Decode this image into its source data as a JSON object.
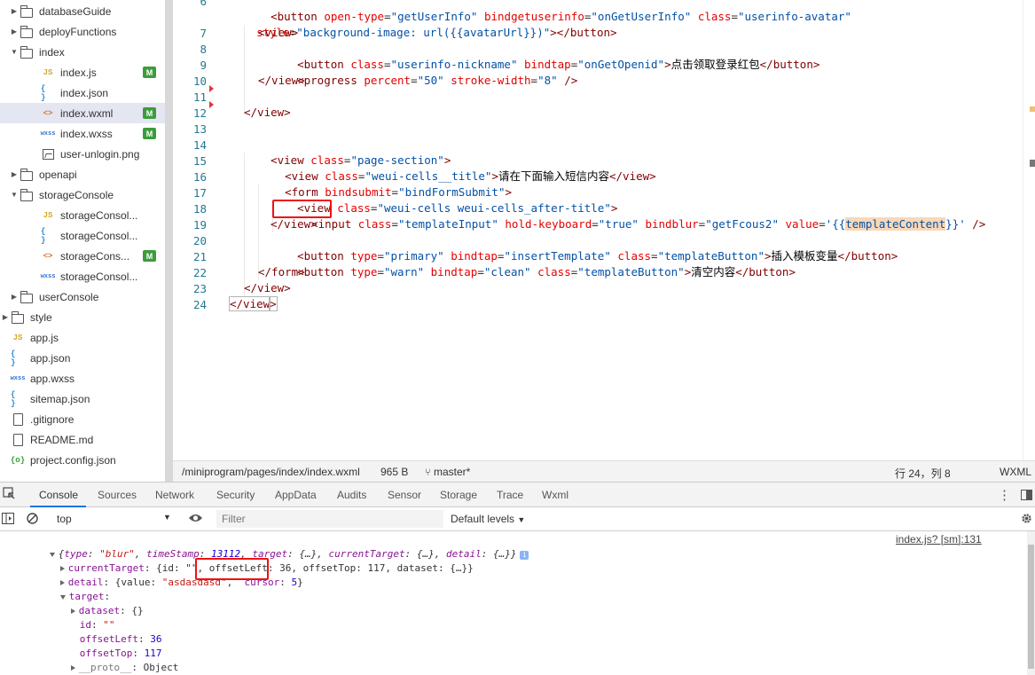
{
  "sidebar": {
    "items": [
      {
        "label": "databaseGuide",
        "kind": "folder",
        "expanded": false,
        "badge": ""
      },
      {
        "label": "deployFunctions",
        "kind": "folder",
        "expanded": false,
        "badge": ""
      },
      {
        "label": "index",
        "kind": "folder",
        "expanded": true,
        "badge": ""
      },
      {
        "label": "index.js",
        "kind": "js",
        "badge": "M"
      },
      {
        "label": "index.json",
        "kind": "json",
        "badge": ""
      },
      {
        "label": "index.wxml",
        "kind": "wxml",
        "badge": "M",
        "selected": true
      },
      {
        "label": "index.wxss",
        "kind": "wxss",
        "badge": "M"
      },
      {
        "label": "user-unlogin.png",
        "kind": "image",
        "badge": ""
      },
      {
        "label": "openapi",
        "kind": "folder",
        "expanded": false,
        "badge": ""
      },
      {
        "label": "storageConsole",
        "kind": "folder",
        "expanded": true,
        "badge": ""
      },
      {
        "label": "storageConsol...",
        "kind": "js",
        "badge": ""
      },
      {
        "label": "storageConsol...",
        "kind": "json",
        "badge": ""
      },
      {
        "label": "storageCons...",
        "kind": "wxml",
        "badge": "M"
      },
      {
        "label": "storageConsol...",
        "kind": "wxss",
        "badge": ""
      },
      {
        "label": "userConsole",
        "kind": "folder",
        "expanded": false,
        "badge": ""
      },
      {
        "label": "style",
        "kind": "folder",
        "expanded": false,
        "badge": ""
      },
      {
        "label": "app.js",
        "kind": "js",
        "badge": ""
      },
      {
        "label": "app.json",
        "kind": "json",
        "badge": ""
      },
      {
        "label": "app.wxss",
        "kind": "wxss",
        "badge": ""
      },
      {
        "label": "sitemap.json",
        "kind": "json",
        "badge": ""
      },
      {
        "label": ".gitignore",
        "kind": "file",
        "badge": ""
      },
      {
        "label": "README.md",
        "kind": "file",
        "badge": ""
      },
      {
        "label": "project.config.json",
        "kind": "config",
        "badge": ""
      }
    ],
    "icon_glyphs": {
      "js": "JS",
      "json": "{ }",
      "wxml": "<>",
      "wxss": "wxss",
      "config": "{o}"
    },
    "badge_color": "#3c9c3c"
  },
  "editor": {
    "line_numbers": [
      "6",
      "7",
      "8",
      "9",
      "10",
      "11",
      "12",
      "13",
      "14",
      "15",
      "16",
      "17",
      "18",
      "19",
      "20",
      "21",
      "22",
      "23",
      "24"
    ],
    "line6": {
      "tag_open": "<button",
      "attr1": "open-type",
      "val1": "\"getUserInfo\"",
      "attr2": "bindgetuserinfo",
      "val2": "\"onGetUserInfo\"",
      "attr3": "class",
      "val3": "\"userinfo-avatar\""
    },
    "line6_wrap": {
      "attr": "style",
      "val": "\"background-image: url({{avatarUrl}})\"",
      "close": "></button>"
    },
    "line7": {
      "tag": "<view>"
    },
    "line8": {
      "tag_open": "<button",
      "attr": "class",
      "val": "\"userinfo-nickname\"",
      "attr2": "bindtap",
      "val2": "\"onGetOpenid\"",
      "close": ">",
      "text": "点击领取登录红包",
      "end": "</button>"
    },
    "line9": {
      "tag_open": "<progress",
      "attr": "percent",
      "val": "\"50\"",
      "attr2": "stroke-width",
      "val2": "\"8\"",
      "close": "/>"
    },
    "line10": {
      "tag": "</view>"
    },
    "line12": {
      "tag": "</view>"
    },
    "line14": {
      "tag_open": "<view",
      "attr": "class",
      "val": "\"page-section\"",
      "close": ">"
    },
    "line15": {
      "tag_open": "<view",
      "attr": "class",
      "val": "\"weui-cells__title\"",
      "close": ">",
      "text": "请在下面输入短信内容",
      "end": "</view>"
    },
    "line16": {
      "tag_open": "<form",
      "attr": "bindsubmit",
      "val": "\"bindFormSubmit\"",
      "close": ">"
    },
    "line17": {
      "tag_open": "<view",
      "attr": "class",
      "val": "\"weui-cells weui-cells_after-title\"",
      "close": ">"
    },
    "line18": {
      "tag_open": "<input",
      "attr": "class",
      "val": "\"templateInput\"",
      "attr2": "hold-keyboard",
      "val2": "\"true\"",
      "attr3": "bindblur",
      "val3": "\"getFcous2\"",
      "attr4": "value",
      "val4_pre": "'{{",
      "val4_hl": "templateContent",
      "val4_post": "}}'",
      "close": "/>"
    },
    "line19": {
      "tag": "</view>"
    },
    "line20": {
      "tag_open": "<button",
      "attr": "type",
      "val": "\"primary\"",
      "attr2": "bindtap",
      "val2": "\"insertTemplate\"",
      "attr3": "class",
      "val3": "\"templateButton\"",
      "close": ">",
      "text": "插入模板变量",
      "end": "</button>"
    },
    "line21": {
      "tag_open": "<button",
      "attr": "type",
      "val": "\"warn\"",
      "attr2": "bindtap",
      "val2": "\"clean\"",
      "attr3": "class",
      "val3": "\"templateButton\"",
      "close": ">",
      "text": "清空内容",
      "end": "</button>"
    },
    "line22": {
      "tag": "</form>"
    },
    "line23": {
      "tag": "</view>"
    },
    "line24": {
      "tag_open": "</view",
      "close": ">"
    }
  },
  "statusbar": {
    "path": "/miniprogram/pages/index/index.wxml",
    "size": "965 B",
    "branch": "master*",
    "position": "行 24，列 8",
    "language": "WXML"
  },
  "devtools": {
    "tabs": [
      "Console",
      "Sources",
      "Network",
      "Security",
      "AppData",
      "Audits",
      "Sensor",
      "Storage",
      "Trace",
      "Wxml"
    ],
    "active_tab": "Console",
    "context": "top",
    "filter_placeholder": "Filter",
    "levels": "Default levels",
    "more_icon": "⋮",
    "console": {
      "source_link": "index.js? [sm]:131",
      "summary": {
        "open": "{",
        "k1": "type",
        "v1": "\"blur\"",
        "k2": "timeStamp",
        "v2": "13112",
        "k3": "target",
        "v3": "{…}",
        "k4": "currentTarget",
        "v4": "{…}",
        "k5": "detail",
        "v5": "{…}",
        "close": "}",
        "info": "i"
      },
      "currentTarget": {
        "key": "currentTarget",
        "rest_a": "{id: \"\", ",
        "rest_b": "offsetLeft: 36, offsetTop: 117, dataset: {…}}"
      },
      "detail": {
        "key": "detail",
        "open": "{value: ",
        "value": "\"asdasdasd\"",
        "sep": ",",
        "cursor_key": "cursor",
        "cursor_val": "5",
        "close": "}"
      },
      "target": {
        "key": "target",
        "colon": ":"
      },
      "dataset": {
        "key": "dataset",
        "val": "{}"
      },
      "id": {
        "key": "id",
        "val": "\"\""
      },
      "offsetLeft": {
        "key": "offsetLeft",
        "val": "36"
      },
      "offsetTop": {
        "key": "offsetTop",
        "val": "117"
      },
      "proto": {
        "key": "__proto__",
        "val": "Object"
      },
      "timeStamp": {
        "key": "timeStamp",
        "val": "13112"
      }
    }
  }
}
